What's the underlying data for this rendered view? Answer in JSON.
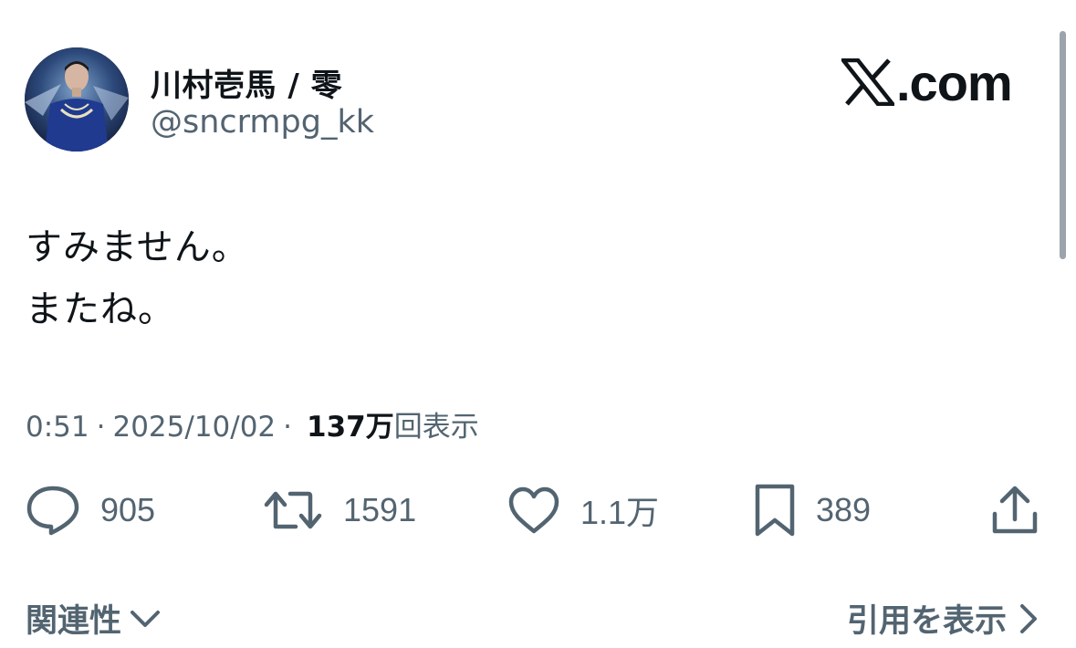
{
  "author": {
    "display_name": "川村壱馬 / 零",
    "handle": "@sncrmpg_kk"
  },
  "brand": {
    "logo_text": ".com",
    "icon": "x-logo-icon"
  },
  "tweet": {
    "lines": [
      "すみません。",
      "またね。"
    ]
  },
  "meta": {
    "time": "0:51",
    "separator": "·",
    "date": "2025/10/02",
    "views_count": "137万",
    "views_label": "回表示"
  },
  "actions": {
    "replies": "905",
    "reposts": "1591",
    "likes": "1.1万",
    "bookmarks": "389"
  },
  "footer": {
    "related_label": "関連性",
    "quotes_label": "引用を表示"
  },
  "colors": {
    "text": "#0f1419",
    "secondary": "#536471",
    "background": "#ffffff"
  }
}
